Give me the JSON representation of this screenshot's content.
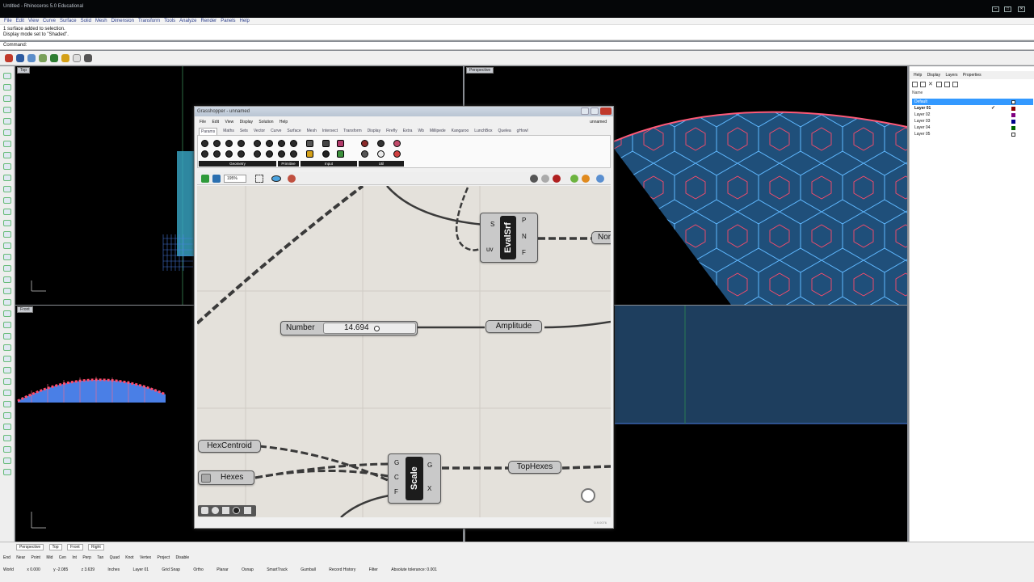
{
  "window": {
    "title": "Untitled - Rhinoceros 5.0 Educational"
  },
  "menubar": [
    "File",
    "Edit",
    "View",
    "Curve",
    "Surface",
    "Solid",
    "Mesh",
    "Dimension",
    "Transform",
    "Tools",
    "Analyze",
    "Render",
    "Panels",
    "Help"
  ],
  "command_history": [
    "1 surface added to selection.",
    "Display mode set to \"Shaded\"."
  ],
  "command_prompt": "Command:",
  "viewports": {
    "top": "Top",
    "perspective": "Perspective",
    "front": "Front"
  },
  "grasshopper": {
    "title": "Grasshopper - unnamed",
    "menu": [
      "File",
      "Edit",
      "View",
      "Display",
      "Solution",
      "Help"
    ],
    "doc_name": "unnamed",
    "tabs": [
      "Params",
      "Maths",
      "Sets",
      "Vector",
      "Curve",
      "Surface",
      "Mesh",
      "Intersect",
      "Transform",
      "Display",
      "Firefly",
      "Extra",
      "Wb",
      "Millipede",
      "Kangaroo",
      "LunchBox",
      "Quelea",
      "gHowl"
    ],
    "active_tab": "Params",
    "categories": [
      "Geometry",
      "Primitive",
      "Input",
      "Util"
    ],
    "zoom": "195%",
    "canvas": {
      "evalsrf": {
        "name": "EvalSrf",
        "inputs": [
          "S",
          "uv"
        ],
        "outputs": [
          "P",
          "N",
          "F"
        ]
      },
      "number_slider": {
        "label": "Number",
        "value": "14.694"
      },
      "amplitude": "Amplitude",
      "normal_partial": "Nor",
      "hexcentroid": "HexCentroid",
      "hexes": "Hexes",
      "scale": {
        "name": "Scale",
        "inputs": [
          "G",
          "C",
          "F"
        ],
        "outputs": [
          "G",
          "X"
        ]
      },
      "tophexes": "TopHexes"
    },
    "version": "0.9.0076"
  },
  "layers": {
    "tabs": [
      "Help",
      "Display",
      "Layers",
      "Properties"
    ],
    "header": "Name",
    "items": [
      {
        "name": "Default",
        "color": "#ffffff",
        "selected": true
      },
      {
        "name": "Layer 01",
        "color": "#8b0000",
        "current": true
      },
      {
        "name": "Layer 02",
        "color": "#800080"
      },
      {
        "name": "Layer 03",
        "color": "#00008b"
      },
      {
        "name": "Layer 04",
        "color": "#006400"
      },
      {
        "name": "Layer 05",
        "color": "#ffffff"
      }
    ]
  },
  "status": {
    "viewport_tabs": [
      "Perspective",
      "Top",
      "Front",
      "Right"
    ],
    "osnaps": [
      "End",
      "Near",
      "Point",
      "Mid",
      "Cen",
      "Int",
      "Perp",
      "Tan",
      "Quad",
      "Knot",
      "Vertex",
      "Project",
      "Disable"
    ],
    "coords": [
      "World",
      "x 0.000",
      "y -2.085",
      "z 3.639",
      "Inches",
      "Layer 01"
    ],
    "toggles": [
      "Grid Snap",
      "Ortho",
      "Planar",
      "Osnap",
      "SmartTrack",
      "Gumball",
      "Record History",
      "Filter",
      "Absolute tolerance: 0.001"
    ]
  }
}
